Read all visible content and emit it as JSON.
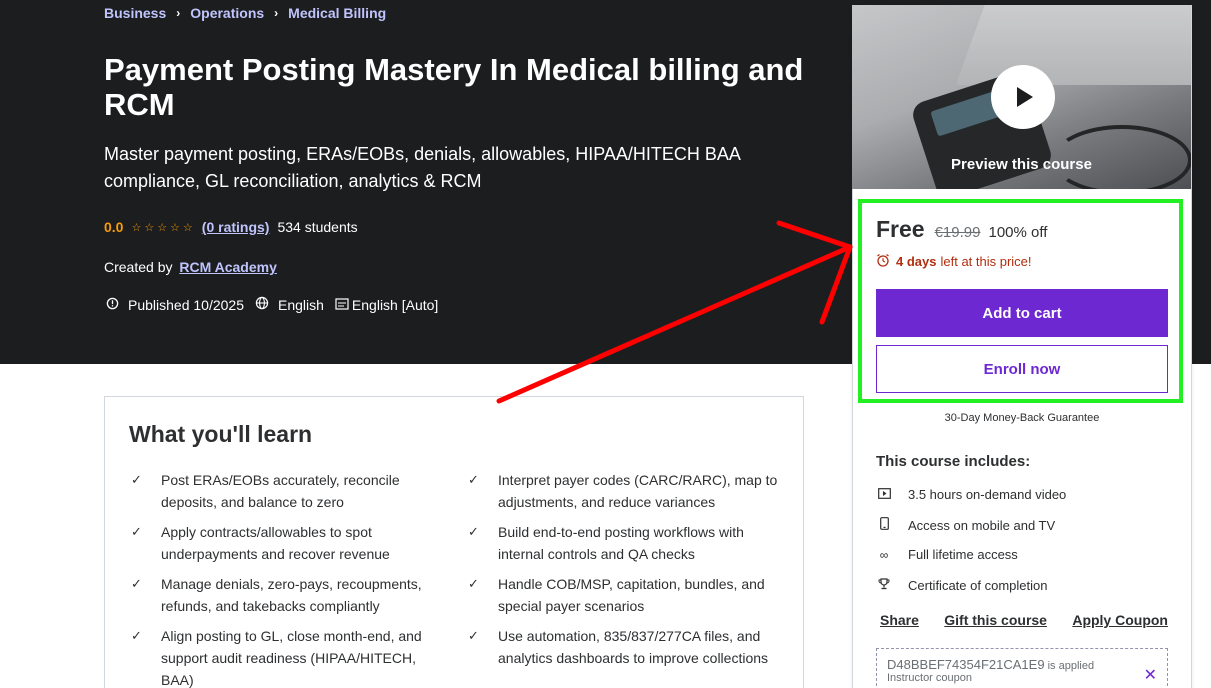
{
  "breadcrumb": {
    "items": [
      "Business",
      "Operations",
      "Medical Billing"
    ]
  },
  "course": {
    "title": "Payment Posting Mastery In Medical billing and RCM",
    "subtitle": "Master payment posting, ERAs/EOBs, denials, allowables, HIPAA/HITECH BAA compliance, GL reconciliation, analytics & RCM",
    "rating": "0.0",
    "stars": "☆☆☆☆☆",
    "ratings_link": "(0 ratings)",
    "students": "534 students",
    "created_by_label": "Created by",
    "author": "RCM Academy",
    "published": "Published 10/2025",
    "language": "English",
    "captions": "English [Auto]"
  },
  "learn": {
    "heading": "What you'll learn",
    "items": [
      "Post ERAs/EOBs accurately, reconcile deposits, and balance to zero",
      "Interpret payer codes (CARC/RARC), map to adjustments, and reduce variances",
      "Apply contracts/allowables to spot underpayments and recover revenue",
      "Build end-to-end posting workflows with internal controls and QA checks",
      "Manage denials, zero-pays, recoupments, refunds, and takebacks compliantly",
      "Handle COB/MSP, capitation, bundles, and special payer scenarios",
      "Align posting to GL, close month-end, and support audit readiness (HIPAA/HITECH, BAA)",
      "Use automation, 835/837/277CA files, and analytics dashboards to improve collections"
    ]
  },
  "sidebar": {
    "preview_label": "Preview this course",
    "price_now": "Free",
    "price_old": "€19.99",
    "discount": "100% off",
    "timer_bold": "4 days",
    "timer_rest": "left at this price!",
    "add_to_cart": "Add to cart",
    "enroll_now": "Enroll now",
    "guarantee": "30-Day Money-Back Guarantee",
    "includes_title": "This course includes:",
    "includes": [
      {
        "icon": "video-icon",
        "text": "3.5 hours on-demand video"
      },
      {
        "icon": "mobile-icon",
        "text": "Access on mobile and TV"
      },
      {
        "icon": "infinity-icon",
        "text": "Full lifetime access"
      },
      {
        "icon": "trophy-icon",
        "text": "Certificate of completion"
      }
    ],
    "share": "Share",
    "gift": "Gift this course",
    "apply_coupon": "Apply Coupon",
    "coupon_code": "D48BBEF74354F21CA1E9",
    "coupon_applied": "is applied",
    "coupon_type": "Instructor coupon"
  },
  "colors": {
    "hero_bg": "#1c1d1f",
    "accent_purple": "#6d28d2",
    "link_lavender": "#c0c4fc",
    "star_orange": "#f69c08",
    "timer_red": "#b32d0f",
    "annotation_green": "#22f022",
    "annotation_red": "#ff0000"
  }
}
